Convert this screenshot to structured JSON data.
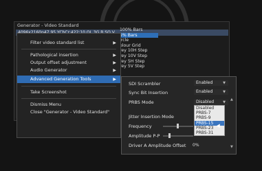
{
  "window": {
    "title": "Generator - Video Standard"
  },
  "video_info": "4096x2160p47.95 YCbCr:422:10 QL 3G B SQ V",
  "standard_list": {
    "items": [
      "100% Bars",
      "5% Bars",
      "ircle",
      "olour Grid",
      "rey 10H Step",
      "rey 10V Step",
      "rey 5H Step",
      "rey 5V Step"
    ],
    "selected_index": 1
  },
  "context_menu": {
    "items": [
      {
        "label": "Filter video standard list",
        "has_submenu": true
      },
      {
        "label": "Pathological insertion",
        "has_submenu": true
      },
      {
        "label": "Output offset adjustment",
        "has_submenu": true
      },
      {
        "label": "Audio Generator",
        "has_submenu": true
      },
      {
        "label": "Advanced Generation Tools",
        "has_submenu": true,
        "highlighted": true
      },
      {
        "label": "Take Screenshot",
        "has_submenu": false
      },
      {
        "label": "Dismiss Menu",
        "has_submenu": false
      },
      {
        "label": "Close \"Generator - Video Standard\"",
        "has_submenu": false
      }
    ]
  },
  "submenu": {
    "sdi_scrambler": {
      "label": "SDI Scrambler",
      "value": "Enabled"
    },
    "sync_bit_insertion": {
      "label": "Sync Bit Insertion",
      "value": "Enabled"
    },
    "prbs_mode": {
      "label": "PRBS Mode",
      "value": "Disabled"
    },
    "jitter_insertion_mode": {
      "label": "Jitter Insertion Mode"
    },
    "frequency": {
      "label": "Frequency"
    },
    "amplitude": {
      "label": "Amplitude P-P"
    },
    "driver_offset": {
      "label": "Driver A Amplitude Offset",
      "value": "0%"
    }
  },
  "prbs_dropdown": {
    "options": [
      "Disabled",
      "PRBS-7",
      "PRBS-9",
      "PRBS-15",
      "PRBS-23",
      "PRBS-31"
    ],
    "hover_index": 3
  },
  "colors": {
    "highlight": "#2f6cb4",
    "background": "#141414"
  }
}
